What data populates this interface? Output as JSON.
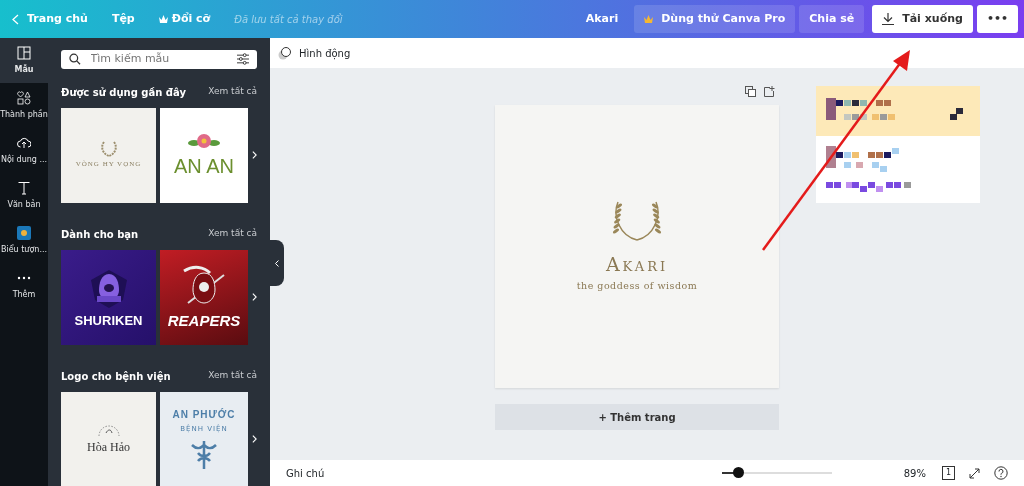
{
  "topbar": {
    "back": "Trang chủ",
    "menu": [
      {
        "label": "Tệp",
        "kind": "plain"
      },
      {
        "label": "Đổi cỡ",
        "kind": "crown"
      }
    ],
    "save_status": "Đã lưu tất cả thay đổi",
    "design_name": "Akari",
    "buttons": [
      {
        "label": "Dùng thử Canva Pro",
        "kind": "pro"
      },
      {
        "label": "Chia sẻ",
        "kind": "share"
      },
      {
        "label": "Tải xuống",
        "kind": "download"
      },
      {
        "label": "•••",
        "kind": "more"
      }
    ]
  },
  "rail": [
    {
      "label": "Mẫu",
      "selected": true
    },
    {
      "label": "Thành phần",
      "selected": false
    },
    {
      "label": "Nội dung ...",
      "selected": false
    },
    {
      "label": "Văn bản",
      "selected": false
    },
    {
      "label": "Biểu tượn...",
      "selected": false
    },
    {
      "label": "Thêm",
      "selected": false
    }
  ],
  "panel": {
    "search": {
      "placeholder": "Tìm kiếm mẫu"
    },
    "sections": [
      {
        "title": "Được sử dụng gần đây",
        "link": "Xem tất cả",
        "templates": [
          {
            "kind": "wreath",
            "title": "VÒNG HY VỌNG"
          },
          {
            "kind": "flower",
            "title": "AN AN"
          }
        ]
      },
      {
        "title": "Dành cho bạn",
        "link": "Xem tất cả",
        "templates": [
          {
            "kind": "hood",
            "title": "SHURIKEN"
          },
          {
            "kind": "reaper",
            "title": "REAPERS"
          }
        ]
      },
      {
        "title": "Logo cho bệnh viện",
        "link": "Xem tất cả",
        "templates": [
          {
            "kind": "script",
            "title": "Hòa Hảo"
          },
          {
            "kind": "caduceus",
            "title": "AN PHƯỚC",
            "subtitle": "BỆNH VIỆN"
          }
        ]
      }
    ]
  },
  "toolbar": {
    "animate": "Hình động"
  },
  "page": {
    "title": "Akari",
    "tagline": "the goddess of wisdom"
  },
  "add_page": "+ Thêm trang",
  "footer": {
    "notes": "Ghi chú",
    "zoom": {
      "level": 0.15
    },
    "zoom_text": "89%",
    "page_count": "1"
  }
}
